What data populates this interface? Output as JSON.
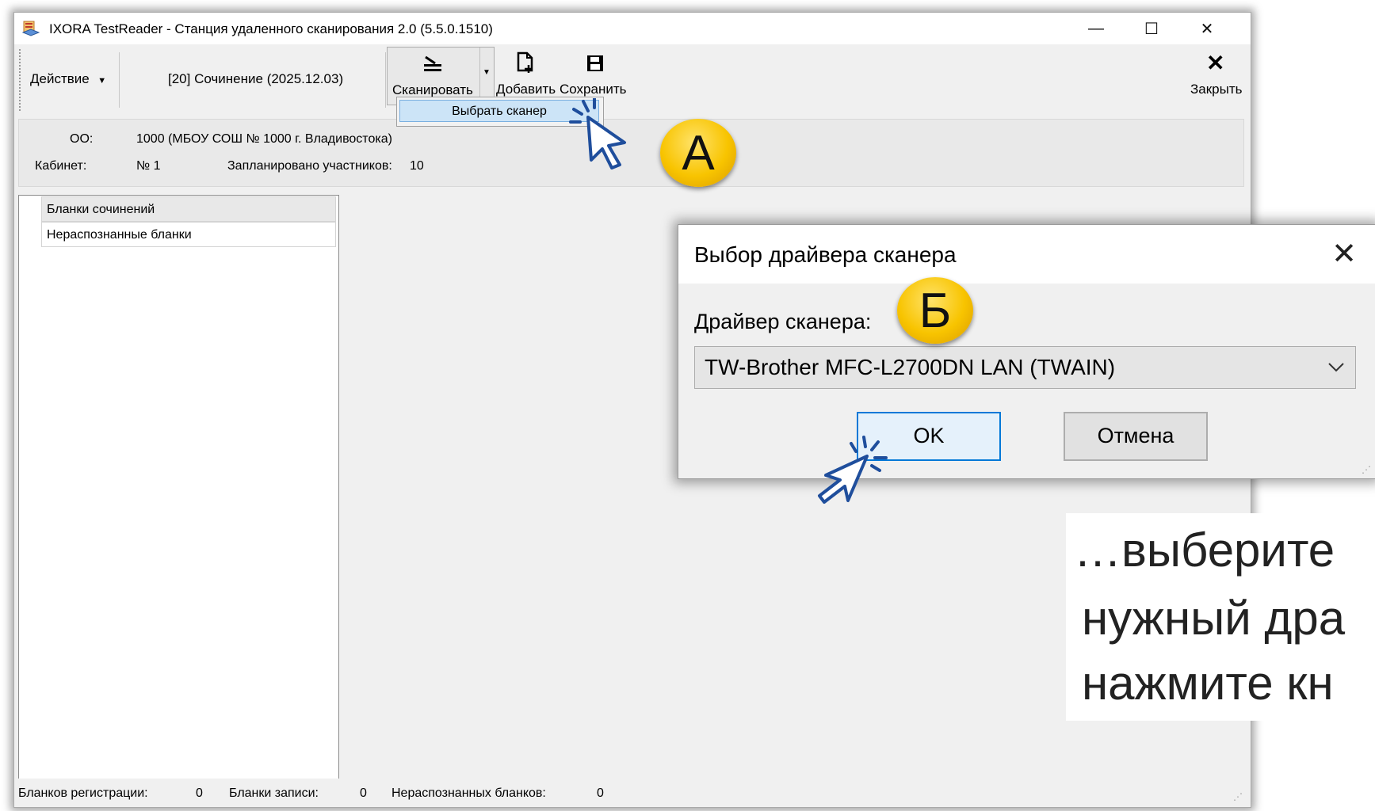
{
  "window": {
    "title": "IXORA TestReader - Станция удаленного сканирования 2.0 (5.5.0.1510)",
    "controls": {
      "minimize": "—",
      "maximize": "☐",
      "close": "✕"
    }
  },
  "toolbar": {
    "action_label": "Действие",
    "session_label": "[20] Сочинение (2025.12.03)",
    "scan_label": "Сканировать",
    "add_label": "Добавить",
    "save_label": "Сохранить",
    "close_label": "Закрыть"
  },
  "scan_menu": {
    "item": "Выбрать сканер"
  },
  "info": {
    "org_label": "ОО:",
    "org_value": "1000 (МБОУ СОШ № 1000 г. Владивостока)",
    "room_label": "Кабинет:",
    "room_value": "№ 1",
    "planned_label": "Запланировано участников:",
    "planned_value": "10"
  },
  "list": {
    "items": [
      "Бланки сочинений",
      "Нераспознанные бланки"
    ]
  },
  "statusbar": {
    "reg_label": "Бланков регистрации:",
    "reg_value": "0",
    "rec_label": "Бланки записи:",
    "rec_value": "0",
    "unrec_label": "Нераспознанных бланков:",
    "unrec_value": "0"
  },
  "dialog": {
    "title": "Выбор драйвера сканера",
    "close": "✕",
    "driver_label": "Драйвер сканера:",
    "driver_value": "TW-Brother MFC-L2700DN LAN (TWAIN)",
    "ok_label": "OK",
    "cancel_label": "Отмена"
  },
  "callouts": {
    "a": "A",
    "b": "Б"
  },
  "instruction": {
    "line1": " …выберите",
    "line2": "нужный дра",
    "line3": "нажмите кн"
  },
  "colors": {
    "badge": "#f8c400",
    "accent": "#0078d7",
    "cursor": "#1f4e9c"
  }
}
